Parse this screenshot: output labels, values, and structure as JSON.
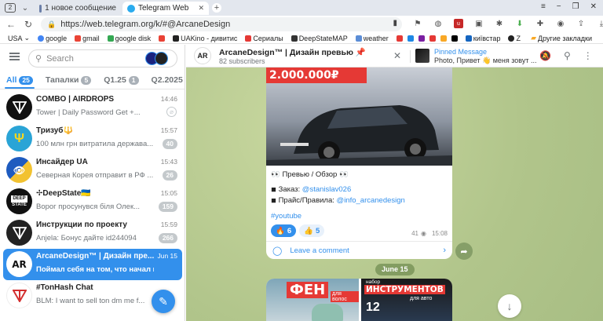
{
  "browser": {
    "tab_counter": "2",
    "tabs": [
      {
        "label": "1 новое сообщение"
      },
      {
        "label": "Telegram Web"
      }
    ],
    "url": "https://web.telegram.org/k/#@ArcaneDesign",
    "bookmarks": [
      {
        "label": "USA",
        "color": "#ffffff"
      },
      {
        "label": "google",
        "color": "#4285f4"
      },
      {
        "label": "gmail",
        "color": "#ea4335"
      },
      {
        "label": "google disk",
        "color": "#34a853"
      },
      {
        "label": "",
        "color": "#e94235"
      },
      {
        "label": "UAKino - дивитис",
        "color": "#222222"
      },
      {
        "label": "Сериалы",
        "color": "#e53935"
      },
      {
        "label": "DeepStateMAP",
        "color": "#333333"
      },
      {
        "label": "weather",
        "color": "#5b8dd6"
      },
      {
        "label": "",
        "color": "#e53935"
      },
      {
        "label": "",
        "color": "#1e88e5"
      },
      {
        "label": "",
        "color": "#7b1fa2"
      },
      {
        "label": "",
        "color": "#e53935"
      },
      {
        "label": "",
        "color": "#f9a825"
      },
      {
        "label": "",
        "color": "#000000"
      },
      {
        "label": "київстар",
        "color": "#1565c0"
      },
      {
        "label": "Z",
        "color": "#222222"
      }
    ],
    "other_bookmarks": "Другие закладки"
  },
  "left": {
    "search_placeholder": "Search",
    "folders": [
      {
        "label": "All",
        "badge": "25",
        "active": true
      },
      {
        "label": "Тапалки",
        "badge": "5",
        "active": false
      },
      {
        "label": "Q1.25",
        "badge": "1",
        "active": false
      },
      {
        "label": "Q2.2025",
        "badge": "",
        "active": false
      }
    ],
    "chats": [
      {
        "title": "COMBO | AIRDROPS",
        "time": "14:46",
        "message": "Tower | Daily Password Get +...",
        "badge": "",
        "pinned": true,
        "avatar": "ton",
        "avatar_color": "#111111"
      },
      {
        "title": "Тризуб🔱",
        "time": "15:57",
        "message": "100 млн грн витратила держава...",
        "badge": "40",
        "pinned": false,
        "avatar": "trident",
        "avatar_color": "#2aa4d6"
      },
      {
        "title": "Инсайдер UA",
        "time": "15:43",
        "message": "Северная Корея отправит в РФ ...",
        "badge": "26",
        "pinned": false,
        "avatar": "insider",
        "avatar_color": "#f2c230"
      },
      {
        "title": "✢DeepState🇺🇦",
        "time": "15:05",
        "message": "Ворог просунувся біля Олек...",
        "badge": "159",
        "pinned": false,
        "avatar": "deepstate",
        "avatar_color": "#111111"
      },
      {
        "title": "Инструкции по проекту",
        "time": "15:59",
        "message": "Anjela: Бонус дайте id244094",
        "badge": "266",
        "pinned": false,
        "avatar": "ton",
        "avatar_color": "#222222"
      },
      {
        "title": "ArcaneDesign™ | Дизайн пре...",
        "time": "Jun 15",
        "message": "Поймал себя на том, что начал кайф...",
        "badge": "",
        "pinned": false,
        "avatar": "AR",
        "avatar_color": "#ffffff",
        "selected": true
      },
      {
        "title": "#TonHash Chat",
        "time": "",
        "message": "BLM: I want to sell ton dm me f...",
        "badge": "",
        "pinned": false,
        "avatar": "tonhash",
        "avatar_color": "#d32f2f"
      }
    ]
  },
  "right": {
    "channel_title": "ArcaneDesign™ | Дизайн превью 📌",
    "subscribers": "82 subscribers",
    "pinned_label": "Pinned Message",
    "pinned_text": "Photo, Привет 👋 меня зовут ...",
    "post": {
      "banner_text": "2.000.000₽",
      "title": "👀 Превью / Обзор 👀",
      "order_label": "◾ Заказ: ",
      "order_link": "@stanislav026",
      "price_label": "◾ Прайс/Правила: ",
      "price_link": "@info_arcanedesign",
      "hashtag": "#youtube",
      "reactions": [
        {
          "emoji": "🔥",
          "count": "6",
          "selected": true
        },
        {
          "emoji": "👍",
          "count": "5",
          "selected": false
        }
      ],
      "views": "41",
      "time": "15:08",
      "comment_label": "Leave a comment"
    },
    "date_pill": "June 15",
    "next_post": {
      "left_text": "ФЕН",
      "left_sub": "для волос",
      "right_top": "набор",
      "right_text": "ИНСТРУМЕНТОВ",
      "right_sub": "для авто",
      "right_num": "12"
    }
  },
  "colors": {
    "accent": "#3390ec",
    "chat_bg": "#b5c98e"
  }
}
